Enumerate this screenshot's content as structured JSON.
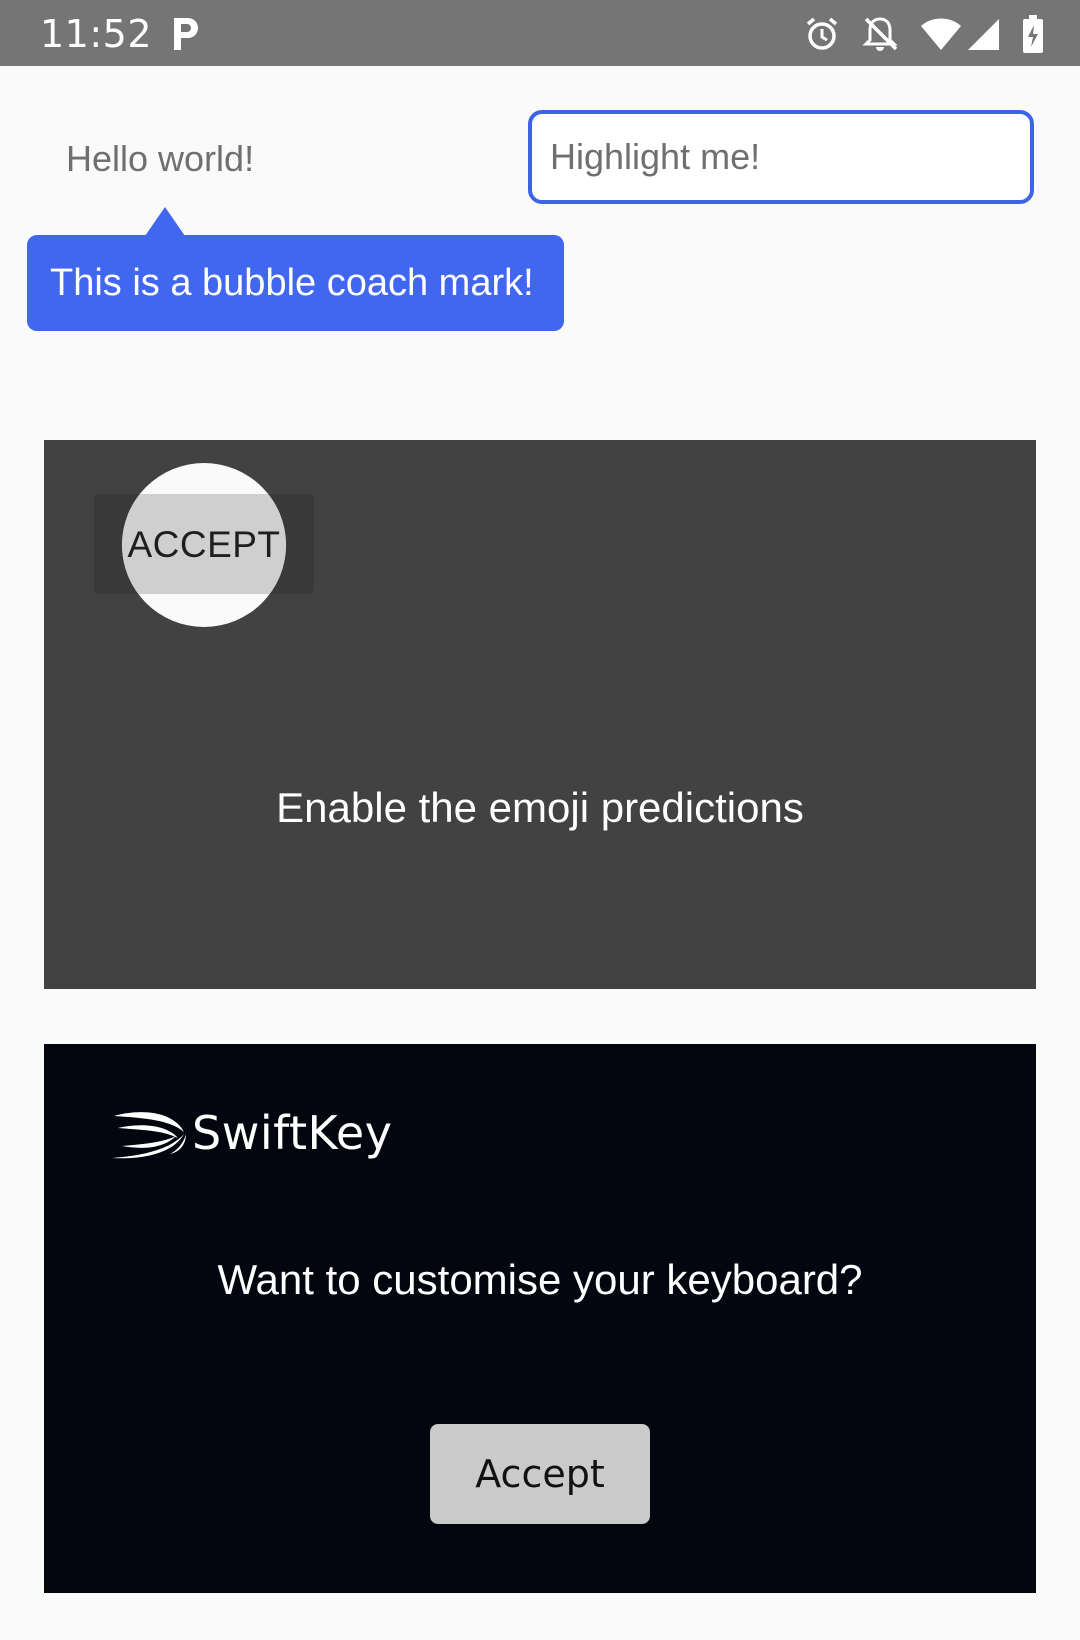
{
  "status_bar": {
    "time": "11:52",
    "icons": [
      "parking-icon",
      "alarm-icon",
      "notifications-off-icon",
      "wifi-icon",
      "cell-signal-icon",
      "battery-charging-icon"
    ],
    "background_color": "#757575"
  },
  "main": {
    "hello_text": "Hello world!",
    "highlight_input": {
      "value": "",
      "placeholder": "Highlight me!",
      "border_color": "#3c64e6"
    },
    "bubble_coach_mark": {
      "text": "This is a bubble coach mark!",
      "color": "#4166f0"
    }
  },
  "emoji_card": {
    "accept_label": "ACCEPT",
    "message": "Enable the emoji predictions",
    "background_color": "#424242"
  },
  "swiftkey_card": {
    "logo_text": "SwiftKey",
    "question": "Want to customise your keyboard?",
    "accept_label": "Accept",
    "background_color": "#03060e"
  }
}
